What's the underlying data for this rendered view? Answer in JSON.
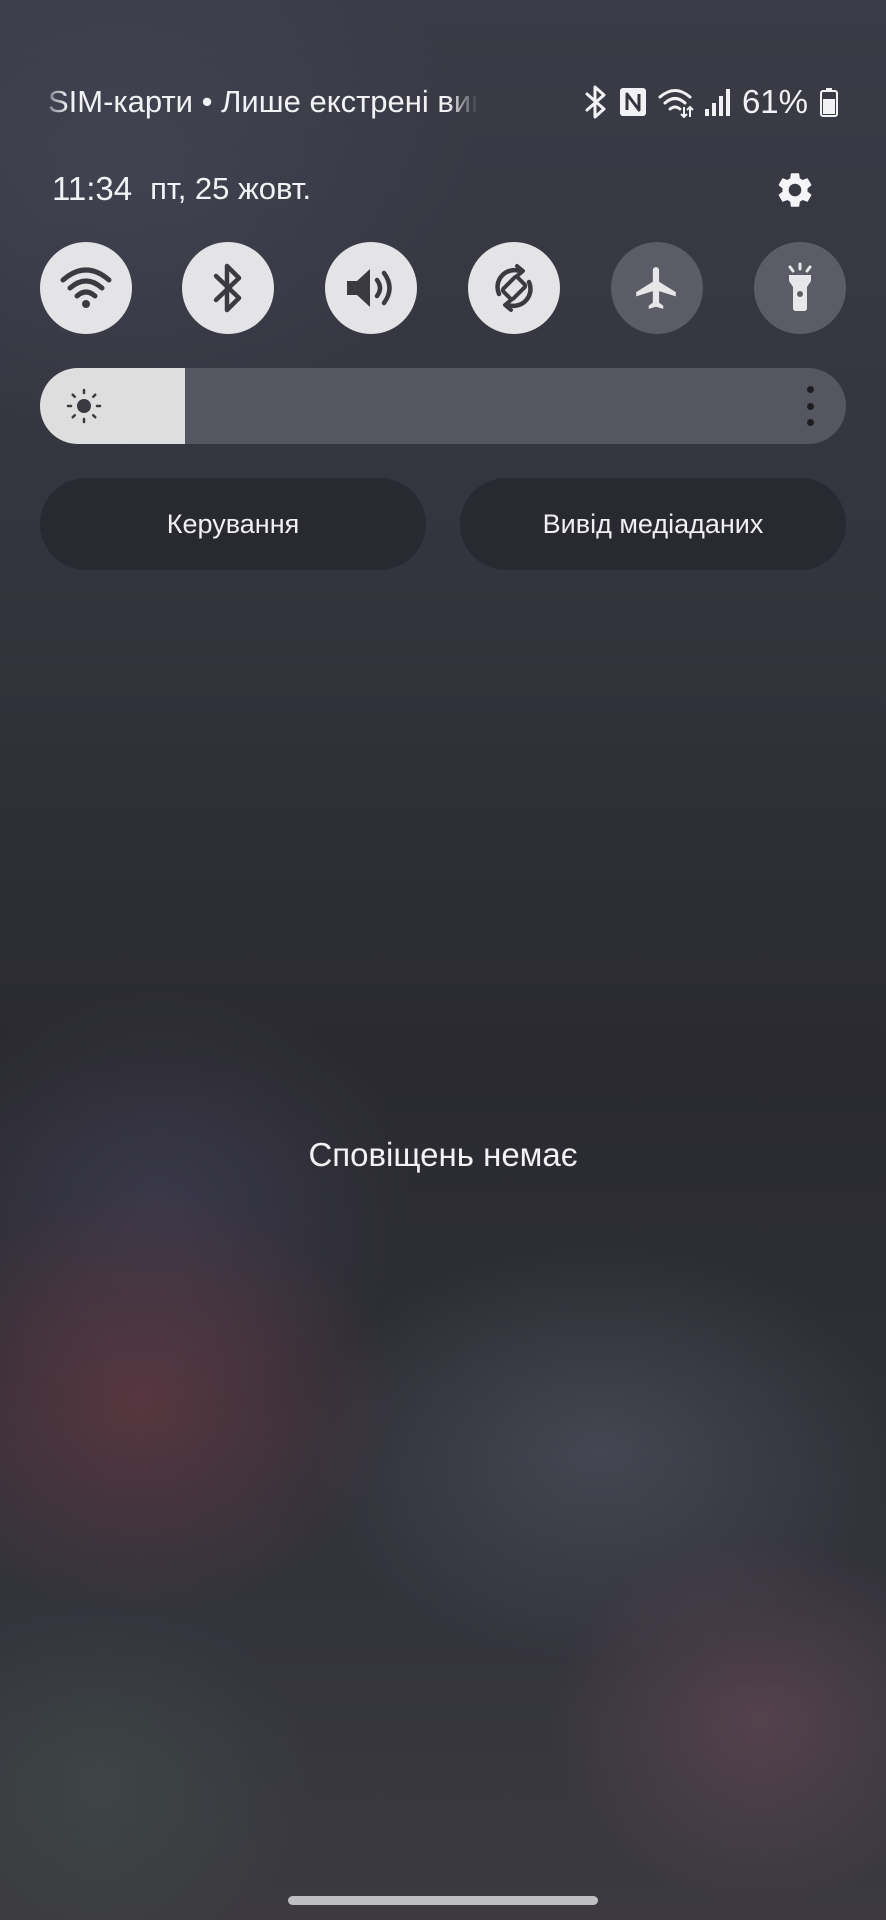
{
  "status_bar": {
    "carrier_text": "SIM-карти • Лише екстрені виклики",
    "icons": [
      "bluetooth-icon",
      "nfc-icon",
      "wifi-calling-icon",
      "signal-icon",
      "battery-icon"
    ],
    "battery_percent": "61%"
  },
  "header": {
    "time": "11:34",
    "date": "пт, 25 жовт.",
    "settings_icon": "gear-icon"
  },
  "quick_toggles": [
    {
      "name": "wifi",
      "icon": "wifi-icon",
      "state": "on"
    },
    {
      "name": "bluetooth",
      "icon": "bluetooth-icon",
      "state": "on"
    },
    {
      "name": "sound",
      "icon": "volume-icon",
      "state": "on"
    },
    {
      "name": "auto-rotate",
      "icon": "rotate-icon",
      "state": "on"
    },
    {
      "name": "airplane-mode",
      "icon": "airplane-icon",
      "state": "off"
    },
    {
      "name": "flashlight",
      "icon": "flashlight-icon",
      "state": "off"
    }
  ],
  "brightness": {
    "level": 0.18,
    "icon": "sun-icon",
    "more_icon": "more-vert-icon"
  },
  "buttons": {
    "controls_label": "Керування",
    "media_output_label": "Вивід медіаданих"
  },
  "notifications": {
    "empty_text": "Сповіщень немає"
  },
  "colors": {
    "tile_on": "#e4e4e7",
    "tile_off": "#5b5c66",
    "icon_dark": "#3a3a40"
  }
}
